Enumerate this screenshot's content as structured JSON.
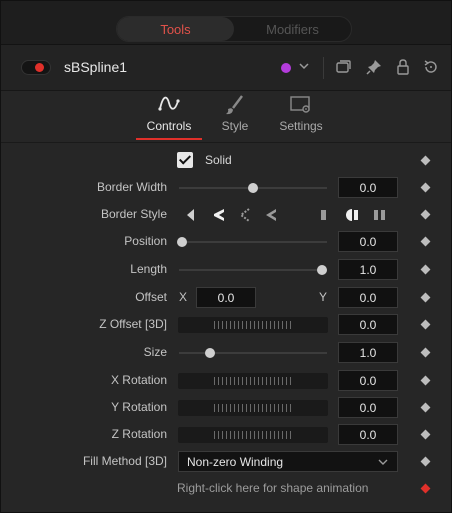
{
  "tabs": {
    "tools": "Tools",
    "modifiers": "Modifiers"
  },
  "tool": {
    "name": "sBSpline1",
    "color": "#b43cdc",
    "enabled": true
  },
  "header_icons": [
    "window-icon",
    "pin-icon",
    "lock-icon",
    "reset-icon"
  ],
  "subtabs": [
    {
      "label": "Controls",
      "icon": "spline-curve-icon",
      "active": true
    },
    {
      "label": "Style",
      "icon": "brush-icon",
      "active": false
    },
    {
      "label": "Settings",
      "icon": "settings-panel-icon",
      "active": false
    }
  ],
  "controls": {
    "solid_label": "Solid",
    "solid_checked": true,
    "border_width": {
      "label": "Border Width",
      "value": "0.0",
      "slider": 0.5
    },
    "border_style": {
      "label": "Border Style"
    },
    "position": {
      "label": "Position",
      "value": "0.0",
      "slider": 0.0
    },
    "length": {
      "label": "Length",
      "value": "1.0",
      "slider": 1.0
    },
    "offset": {
      "label": "Offset",
      "x_label": "X",
      "x_value": "0.0",
      "y_label": "Y",
      "y_value": "0.0"
    },
    "z_offset": {
      "label": "Z Offset [3D]",
      "value": "0.0"
    },
    "size": {
      "label": "Size",
      "value": "1.0",
      "slider": 0.2
    },
    "x_rotation": {
      "label": "X Rotation",
      "value": "0.0"
    },
    "y_rotation": {
      "label": "Y Rotation",
      "value": "0.0"
    },
    "z_rotation": {
      "label": "Z Rotation",
      "value": "0.0"
    },
    "fill_method": {
      "label": "Fill Method [3D]",
      "value": "Non-zero Winding"
    },
    "hint": "Right-click here for shape animation"
  }
}
